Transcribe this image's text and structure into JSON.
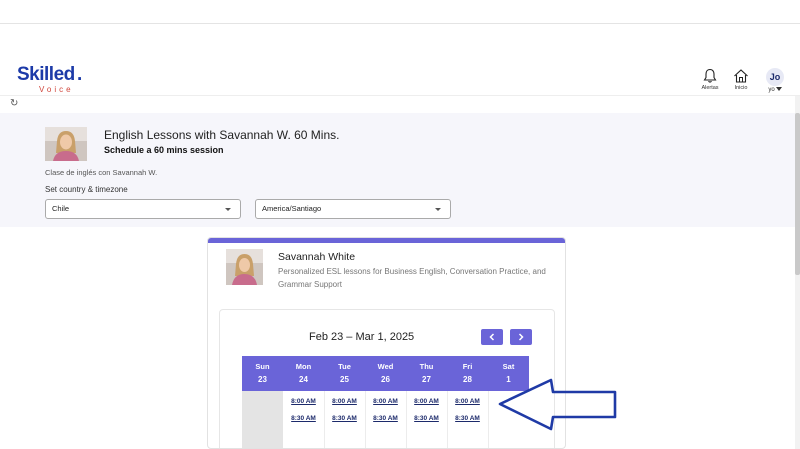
{
  "header": {
    "logo": {
      "main": "Skilled",
      "dot": ".",
      "sub": "Voice"
    },
    "alerts_label": "Alertas",
    "home_label": "Inicio",
    "user": {
      "initials": "Jo",
      "sub": "yo"
    }
  },
  "session": {
    "title": "English Lessons with Savannah W. 60 Mins.",
    "subtitle": "Schedule a 60 mins session",
    "note": "Clase de inglés con Savannah W.",
    "tz_label": "Set country & timezone",
    "country": "Chile",
    "timezone": "America/Santiago"
  },
  "tutor": {
    "name": "Savannah White",
    "description": "Personalized ESL lessons for Business English, Conversation Practice, and Grammar Support"
  },
  "calendar": {
    "range": "Feb 23 – Mar 1, 2025",
    "days": [
      {
        "name": "Sun",
        "date": "23"
      },
      {
        "name": "Mon",
        "date": "24"
      },
      {
        "name": "Tue",
        "date": "25"
      },
      {
        "name": "Wed",
        "date": "26"
      },
      {
        "name": "Thu",
        "date": "27"
      },
      {
        "name": "Fri",
        "date": "28"
      },
      {
        "name": "Sat",
        "date": "1"
      }
    ],
    "slots": {
      "mon": [
        "8:00 AM",
        "8:30 AM"
      ],
      "tue": [
        "8:00 AM",
        "8:30 AM"
      ],
      "wed": [
        "8:00 AM",
        "8:30 AM"
      ],
      "thu": [
        "8:00 AM",
        "8:30 AM"
      ],
      "fri": [
        "8:00 AM",
        "8:30 AM"
      ]
    }
  },
  "colors": {
    "accent": "#6a64d8",
    "brand": "#1c3aa8",
    "annotation_arrow": "#1f3aa6"
  }
}
